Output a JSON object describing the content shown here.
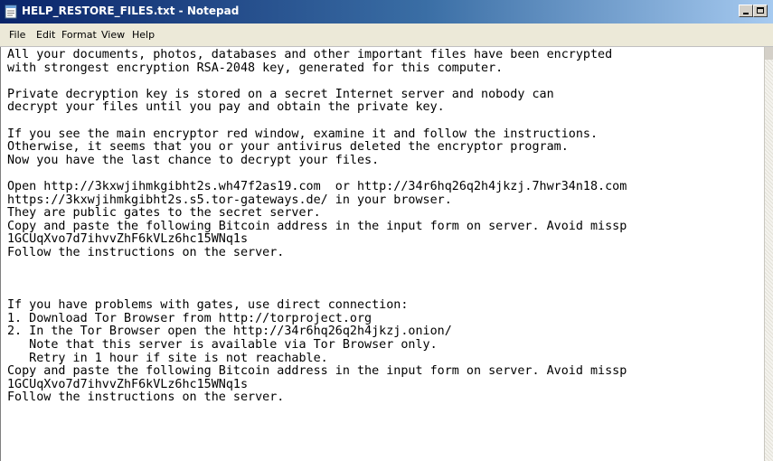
{
  "window": {
    "title": "HELP_RESTORE_FILES.txt - Notepad"
  },
  "menu": {
    "file": "File",
    "edit": "Edit",
    "format": "Format",
    "view": "View",
    "help": "Help"
  },
  "document": {
    "lines": [
      "All your documents, photos, databases and other important files have been encrypted",
      "with strongest encryption RSA-2048 key, generated for this computer.",
      "",
      "Private decryption key is stored on a secret Internet server and nobody can",
      "decrypt your files until you pay and obtain the private key.",
      "",
      "If you see the main encryptor red window, examine it and follow the instructions.",
      "Otherwise, it seems that you or your antivirus deleted the encryptor program.",
      "Now you have the last chance to decrypt your files.",
      "",
      "Open http://3kxwjihmkgibht2s.wh47f2as19.com  or http://34r6hq26q2h4jkzj.7hwr34n18.com",
      "https://3kxwjihmkgibht2s.s5.tor-gateways.de/ in your browser.",
      "They are public gates to the secret server.",
      "Copy and paste the following Bitcoin address in the input form on server. Avoid missp",
      "1GCUqXvo7d7ihvvZhF6kVLz6hc15WNq1s",
      "Follow the instructions on the server.",
      "",
      "",
      "",
      "If you have problems with gates, use direct connection:",
      "1. Download Tor Browser from http://torproject.org",
      "2. In the Tor Browser open the http://34r6hq26q2h4jkzj.onion/",
      "   Note that this server is available via Tor Browser only.",
      "   Retry in 1 hour if site is not reachable.",
      "Copy and paste the following Bitcoin address in the input form on server. Avoid missp",
      "1GCUqXvo7d7ihvvZhF6kVLz6hc15WNq1s",
      "Follow the instructions on the server."
    ]
  },
  "icons": {
    "title": "notepad-icon"
  },
  "colors": {
    "titlebar_start": "#0a246a",
    "titlebar_end": "#a6caf0",
    "menubar": "#ece9d8",
    "text": "#000000"
  }
}
